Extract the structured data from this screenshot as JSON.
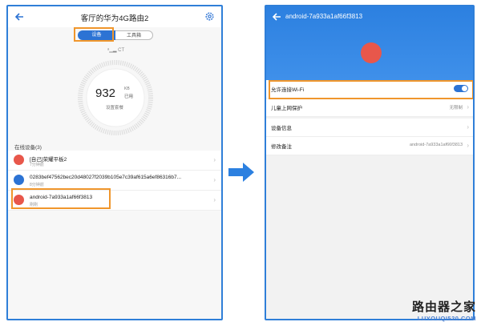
{
  "left": {
    "title": "客厅的华为4G路由2",
    "tabs": [
      {
        "label": "设备"
      },
      {
        "label": "工具箱"
      }
    ],
    "signal": "CT",
    "usage": {
      "value": "932",
      "unit": "KB",
      "used_label": "已用",
      "subtitle": "设置套餐"
    },
    "online_header": "在线设备(3)",
    "devices": [
      {
        "name": "[自己]荣耀平板2",
        "time": "7分钟前",
        "icon": "huawei-logo",
        "color": "#e8574b"
      },
      {
        "name": "0283bef47562bec20d48027f2039b105e7c39af615a6ef86316b7...",
        "time": "8分钟前",
        "icon": "router-icon",
        "color": "#2c73d4"
      },
      {
        "name": "android-7a933a1af66f3813",
        "time": "刚刚",
        "icon": "huawei-logo",
        "color": "#e8574b"
      }
    ]
  },
  "right": {
    "title": "android-7a933a1af66f3813",
    "settings_group1": [
      {
        "label": "允许连接Wi-Fi",
        "toggle_on": true
      },
      {
        "label": "儿童上网保护",
        "value": "无限制"
      }
    ],
    "settings_group2": [
      {
        "label": "设备信息",
        "value": ""
      },
      {
        "label": "修改备注",
        "value": "android-7a933a1af66f3813"
      }
    ]
  },
  "watermark": {
    "name": "路由器之家",
    "url": "LUYOUQI520.COM"
  },
  "colors": {
    "accent": "#2c73d4",
    "highlight": "#f0962c",
    "huawei_red": "#e8574b"
  }
}
